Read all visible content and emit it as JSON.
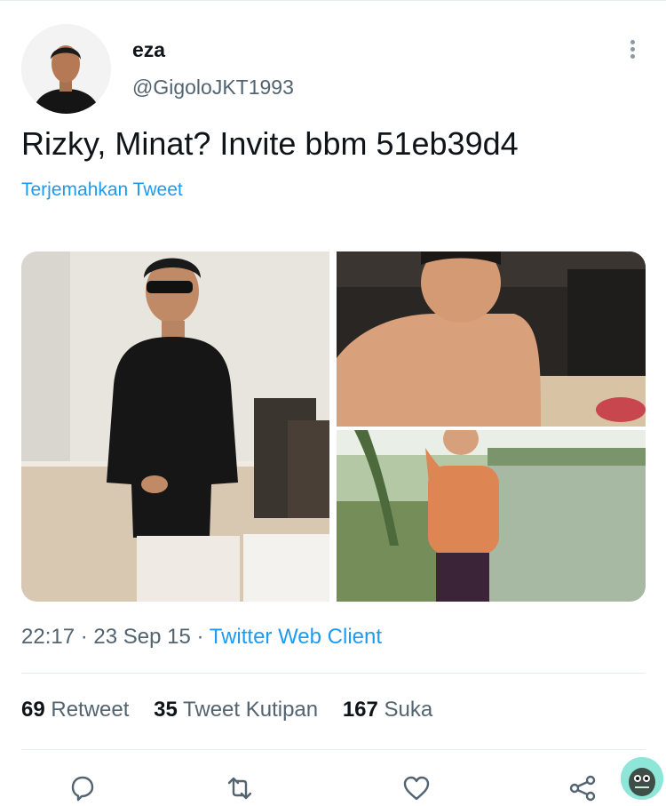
{
  "tweet": {
    "display_name": "eza",
    "handle": "@GigoloJKT1993",
    "text": "Rizky, Minat? Invite bbm 51eb39d4",
    "translate_label": "Terjemahkan Tweet",
    "time": "22:17",
    "date": "23 Sep 15",
    "source": "Twitter Web Client"
  },
  "stats": {
    "retweets": {
      "count": "69",
      "label": "Retweet"
    },
    "quotes": {
      "count": "35",
      "label": "Tweet Kutipan"
    },
    "likes": {
      "count": "167",
      "label": "Suka"
    }
  },
  "icons": {
    "more": "more-vertical-icon",
    "reply": "reply-icon",
    "retweet": "retweet-icon",
    "like": "heart-icon",
    "share": "share-icon"
  },
  "colors": {
    "accent": "#1d9bf0",
    "secondary_text": "#536471",
    "icon": "#536471"
  }
}
